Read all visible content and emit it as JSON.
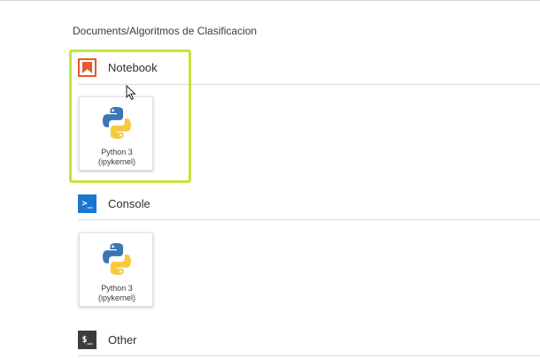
{
  "breadcrumb": "Documents/Algoritmos de Clasificacion",
  "sections": {
    "notebook": {
      "title": "Notebook",
      "icon": "notebook-bookmark-icon",
      "icon_color": "#e8582a",
      "kernels": [
        {
          "line1": "Python 3",
          "line2": "(ipykernel)",
          "icon": "python-logo-icon"
        }
      ]
    },
    "console": {
      "title": "Console",
      "icon": "console-prompt-icon",
      "icon_glyph": ">_",
      "icon_color": "#1976d2",
      "kernels": [
        {
          "line1": "Python 3",
          "line2": "(ipykernel)",
          "icon": "python-logo-icon"
        }
      ]
    },
    "other": {
      "title": "Other",
      "icon": "terminal-dollar-icon",
      "icon_glyph": "$_",
      "icon_color": "#3c3c3c"
    }
  },
  "highlight_color": "#c5e43c"
}
